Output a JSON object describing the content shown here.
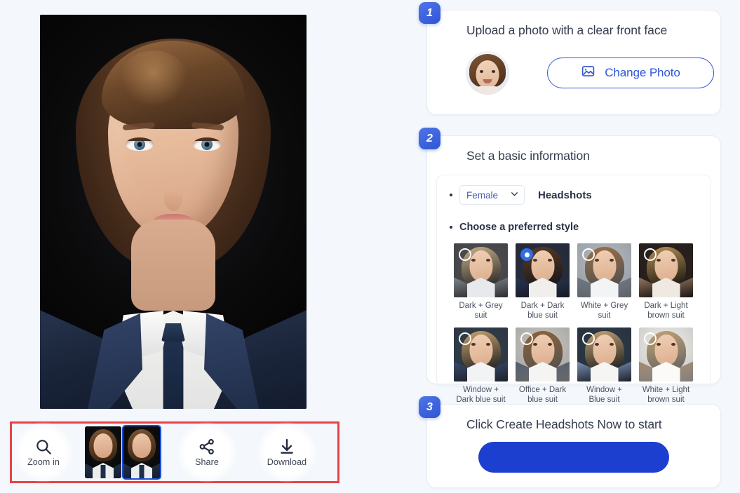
{
  "theme": {
    "page_bg": "#f4f7fb",
    "accent_blue": "#2f55d4",
    "badge_blue": "#2f55d4",
    "highlight_red": "#e8414a",
    "selected_outline": "#1d4ed8",
    "create_button_blue": "#1d3fd0"
  },
  "preview": {
    "alt": "generated-headshot-preview"
  },
  "toolbar": {
    "zoom_in_label": "Zoom in",
    "zoom_in_icon": "magnifier-icon",
    "share_label": "Share",
    "share_icon": "share-nodes-icon",
    "download_label": "Download",
    "download_icon": "download-arrow-icon",
    "thumbnails": [
      {
        "name": "result-thumbnail-1",
        "selected": false
      },
      {
        "name": "result-thumbnail-2",
        "selected": true
      }
    ]
  },
  "steps": [
    {
      "number": "1",
      "title": "Upload a photo with a clear front face",
      "avatar_name": "uploaded-photo-avatar",
      "button_label": "Change Photo",
      "button_icon": "image-icon"
    },
    {
      "number": "2",
      "title": "Set a basic information",
      "gender_select": {
        "value": "Female",
        "chevron_icon": "chevron-down-icon"
      },
      "headshots_label": "Headshots",
      "choose_style_label": "Choose a preferred style",
      "styles": [
        {
          "label": "Dark + Grey suit",
          "selected": false,
          "bg": "#4f5054",
          "hair": "#c9b089",
          "suit": "#8d939c",
          "shirt": "#e8e9ec"
        },
        {
          "label": "Dark + Dark blue suit",
          "selected": true,
          "bg": "#2b3041",
          "hair": "#5d3c24",
          "suit": "#2a3a5a",
          "shirt": "#f0efec"
        },
        {
          "label": "White + Grey suit",
          "selected": false,
          "bg": "#b6bcc4",
          "hair": "#9b7046",
          "suit": "#6e7885",
          "shirt": "#f3f4f6"
        },
        {
          "label": "Dark + Light brown suit",
          "selected": false,
          "bg": "#2c2320",
          "hair": "#b89257",
          "suit": "#a8876c",
          "shirt": "#efe9e2"
        },
        {
          "label": "Window + Dark blue suit",
          "selected": false,
          "bg": "#34404e",
          "hair": "#caa46d",
          "suit": "#3c5075",
          "shirt": "#f2f3f4"
        },
        {
          "label": "Office + Dark blue suit",
          "selected": false,
          "bg": "#c9c7c2",
          "hair": "#8d6239",
          "suit": "#49596f",
          "shirt": "#f4f4f3"
        },
        {
          "label": "Window + Blue suit",
          "selected": false,
          "bg": "#2e3b48",
          "hair": "#c6a472",
          "suit": "#8ea4cd",
          "shirt": "#f5f5f3"
        },
        {
          "label": "White + Light brown suit",
          "selected": false,
          "bg": "#f2f1ee",
          "hair": "#c3a173",
          "suit": "#a98a6b",
          "shirt": "#fbfaf8"
        }
      ]
    },
    {
      "number": "3",
      "title": "Click Create Headshots Now to start",
      "create_button_name": "create-headshots-now-button"
    }
  ]
}
